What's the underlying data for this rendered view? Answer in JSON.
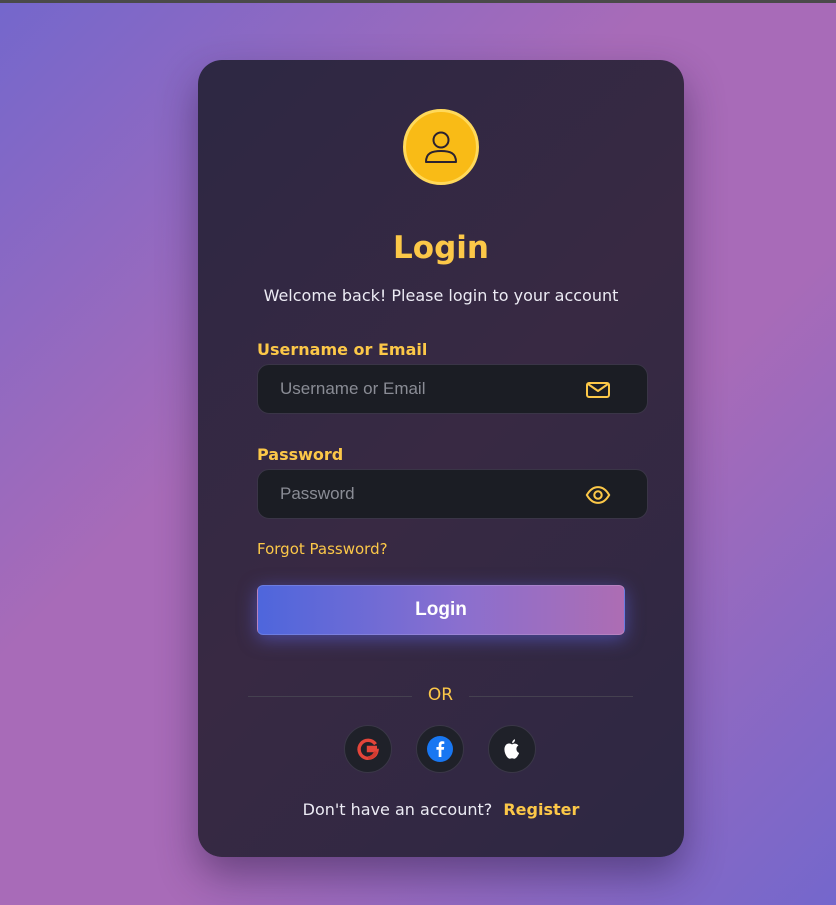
{
  "login": {
    "title": "Login",
    "subtitle": "Welcome back! Please login to your account",
    "avatar_icon": "user-icon",
    "username": {
      "label": "Username or Email",
      "placeholder": "Username or Email",
      "value": "",
      "icon": "envelope-icon"
    },
    "password": {
      "label": "Password",
      "placeholder": "Password",
      "value": "",
      "icon": "eye-icon"
    },
    "forgot_password": "Forgot Password?",
    "submit_label": "Login",
    "divider_text": "OR",
    "social": [
      {
        "name": "google",
        "icon": "google-icon"
      },
      {
        "name": "facebook",
        "icon": "facebook-icon"
      },
      {
        "name": "apple",
        "icon": "apple-icon"
      }
    ],
    "signup_prompt": "Don't have an account?",
    "signup_link": "Register"
  },
  "colors": {
    "accent": "#fcc848",
    "avatar": "#f9bb16",
    "card": "#2d2843",
    "button_start": "#4e66dc",
    "button_end": "#ad6db3",
    "input_bg": "#1b1d24",
    "background_start": "#7467cc",
    "background_mid": "#a86bb8"
  }
}
